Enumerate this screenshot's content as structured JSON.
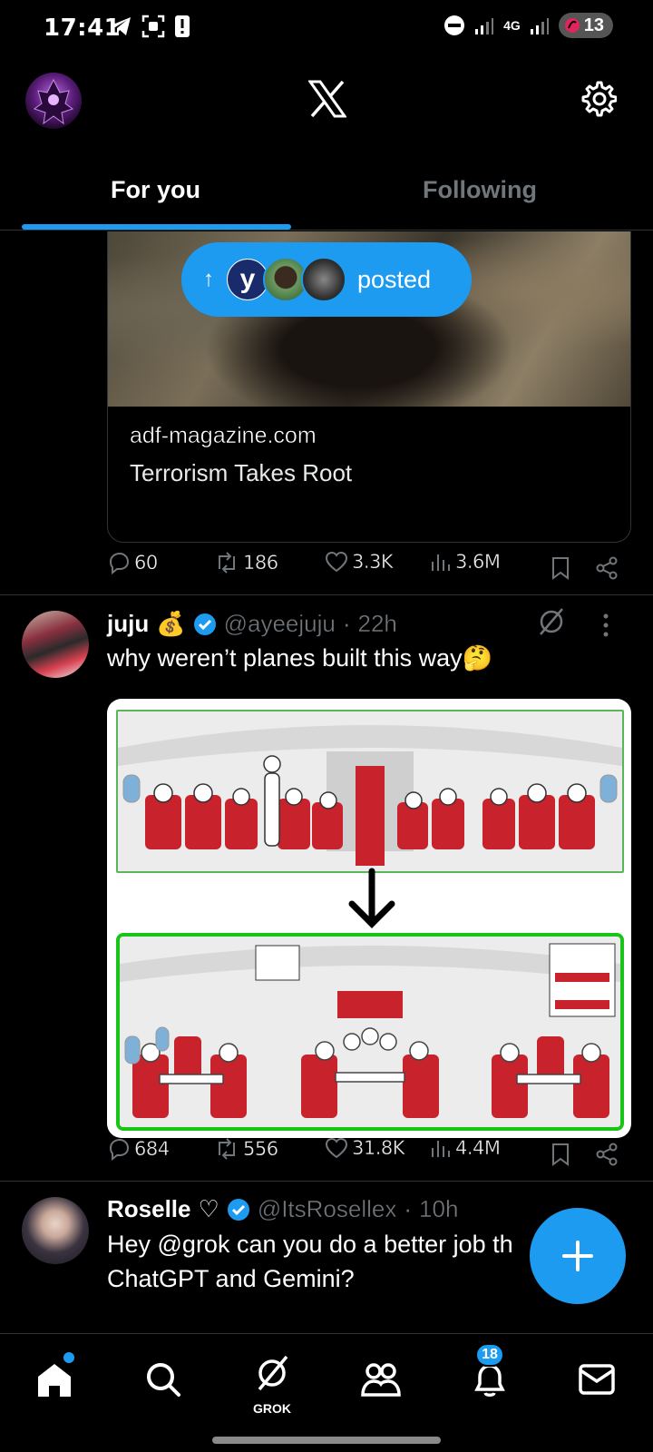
{
  "status_bar": {
    "time": "17:41",
    "network": "4G",
    "battery": "13",
    "icons_left": [
      "telegram-icon",
      "screenshot-icon",
      "alert-icon"
    ],
    "icons_right": [
      "dnd-icon",
      "signal-icon",
      "signal-icon",
      "battery-icon"
    ]
  },
  "header": {
    "logo": "X",
    "settings_icon": "gear-icon"
  },
  "tabs": [
    {
      "label": "For you",
      "active": true
    },
    {
      "label": "Following",
      "active": false
    }
  ],
  "posted_pill": {
    "text": "posted",
    "first_avatar_letter": "y"
  },
  "link_card": {
    "domain": "adf-magazine.com",
    "title": "Terrorism Takes Root"
  },
  "post1_actions": {
    "replies": "60",
    "reposts": "186",
    "likes": "3.3K",
    "views": "3.6M"
  },
  "post2": {
    "name": "juju",
    "name_emoji": "💰",
    "handle": "@ayeejuju",
    "time": "22h",
    "text": "why weren’t planes built this way",
    "text_emoji": "🤔",
    "actions": {
      "replies": "684",
      "reposts": "556",
      "likes": "31.8K",
      "views": "4.4M"
    }
  },
  "post3": {
    "name": "Roselle",
    "name_symbol": "♡",
    "handle": "@ItsRosellex",
    "time": "10h",
    "text_line1": "Hey @grok  can you do a better job th",
    "text_line2": "ChatGPT and Gemini?"
  },
  "bottom_nav": {
    "grok_label": "GROK",
    "notifications_count": "18"
  },
  "colors": {
    "accent": "#1d9bf0",
    "background": "#000000",
    "muted": "#71767b",
    "divider": "#2f3336"
  }
}
